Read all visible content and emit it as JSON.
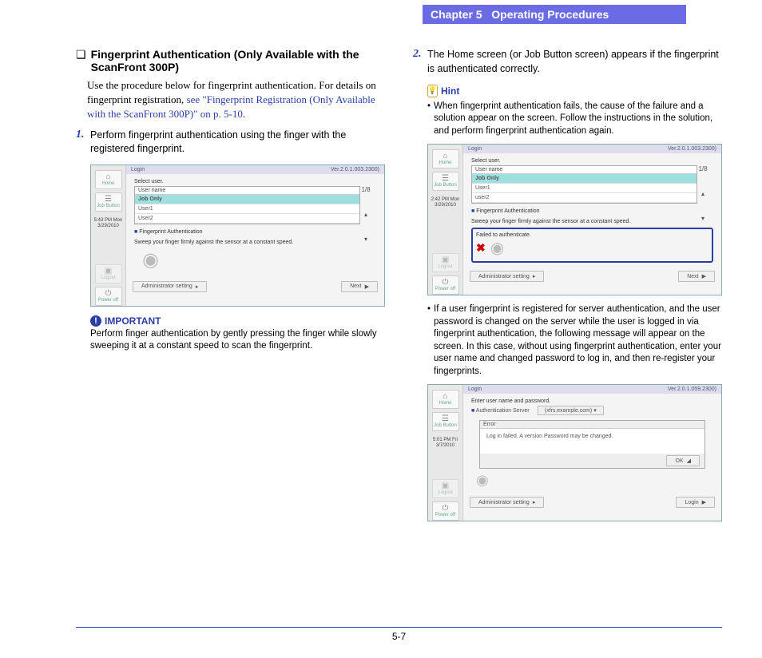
{
  "header": {
    "chapter": "Chapter 5",
    "title": "Operating Procedures"
  },
  "left": {
    "section_title": "Fingerprint Authentication (Only Available with the ScanFront 300P)",
    "intro": "Use the procedure below for fingerprint authentication. For details on fingerprint registration, ",
    "intro_link": "see \"Fingerprint Registration (Only Available with the ScanFront 300P)\" on p. 5-10",
    "intro_end": ".",
    "step1_num": "1.",
    "step1": "Perform fingerprint authentication using the finger with the registered fingerprint.",
    "fig1": {
      "home": "Home",
      "jobbtn": "Job Button",
      "time": "5:43 PM  Mon",
      "date": "3/29/2010",
      "logout": "Logout",
      "power": "Power off",
      "login": "Login",
      "ver": "Ver.2.0.1.003.2300)",
      "select": "Select user.",
      "th": "User name",
      "pg": "1/8",
      "r1": "Job Only",
      "r2": "User1",
      "r3": "User2",
      "fp_label": "Fingerprint Authentication",
      "fp_hint": "Sweep your finger firmly against the sensor at a constant speed.",
      "admin": "Administrator setting",
      "next": "Next"
    },
    "important_label": "IMPORTANT",
    "important_text": "Perform finger authentication by gently pressing the finger while slowly sweeping it at a constant speed to scan the fingerprint."
  },
  "right": {
    "step2_num": "2.",
    "step2": "The Home screen (or Job Button screen) appears if the fingerprint is authenticated correctly.",
    "hint_label": "Hint",
    "hint_b1": "When fingerprint authentication fails, the cause of the failure and a solution appear on the screen. Follow the instructions in the solution, and perform fingerprint authentication again.",
    "fig2": {
      "home": "Home",
      "jobbtn": "Job Button",
      "time": "2:42 PM  Mon",
      "date": "3/29/2010",
      "logout": "Logout",
      "power": "Power off",
      "login": "Login",
      "ver": "Ver.2.0.1.003.2300)",
      "select": "Select user.",
      "th": "User name",
      "pg": "1/8",
      "r1": "Job Only",
      "r2": "User1",
      "r3": "user2",
      "fp_label": "Fingerprint Authentication",
      "fp_hint": "Sweep your finger firmly against the sensor at a constant speed.",
      "fail": "Failed to authenticate.",
      "admin": "Administrator setting",
      "next": "Next"
    },
    "hint_b2": "If a user fingerprint is registered for server authentication, and the user password is changed on the server while the user is logged in via fingerprint authentication, the following message will appear on the screen. In this case, without using fingerprint authentication, enter your user name and changed password to log in, and then re-register your fingerprints.",
    "fig3": {
      "home": "Home",
      "jobbtn": "Job Button",
      "time": "5:01 PM  Fri",
      "date": "3/7/2010",
      "logout": "Logout",
      "power": "Power off",
      "login": "Login",
      "ver": "Ver.2.0.1.059.2300)",
      "enter": "Enter user name and password.",
      "auth_label": "Authentication Server",
      "auth_val": "(xfrs.example.com)",
      "err_head": "Error",
      "err_body": "Log in failed. A version Password may be changed.",
      "ok": "OK",
      "admin": "Administrator setting",
      "loginbtn": "Login"
    }
  },
  "footer": {
    "page": "5-7"
  }
}
